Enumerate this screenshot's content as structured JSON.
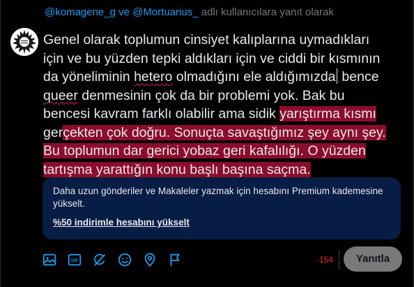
{
  "reply_context": {
    "mentions": "@komagene_g ve @Mortuarius_",
    "suffix": "adlı kullanıcılara yanıt olarak"
  },
  "compose": {
    "line1": "Genel olarak toplumun cinsiyet kalıplarına uymadıkları",
    "line2": "için ve bu yüzden tepki aldıkları için ve ciddi bir kısmının",
    "line3_pre": "da yöneliminin ",
    "line3_sq": "hetero",
    "line3_mid": " olmadığını ele aldığımızda",
    "line3_post": " bence",
    "line4_sq": "queer",
    "line4_post": " denmesinin çok da bir problemi yok. Bak bu",
    "line5_pre": "bencesi kavram farklı olabilir ama sidik ",
    "line5_hl": "yarıştırma kısmı",
    "line6_pre": "ger",
    "line6_hl": "çekten çok doğru. Sonuçta savaştığımız şey aynı şey.",
    "line7_hl": "Bu toplumun dar gerici yobaz geri kafalılığı. O yüzden",
    "line8_hl": "tartışma yarattığın konu  başlı başına saçma."
  },
  "premium": {
    "message": "Daha uzun gönderiler ve Makaleler yazmak için hesabını Premium kademesine yükselt.",
    "cta": "%50 indirimle hesabını yükselt"
  },
  "toolbar": {
    "icons": [
      "image-icon",
      "gif-icon",
      "grok-icon",
      "emoji-icon",
      "location-icon",
      "schedule-icon"
    ]
  },
  "char_counter": "-154",
  "reply_button": "Yanıtla",
  "colors": {
    "background": "#000000",
    "accent": "#1d9bf0",
    "overflow_highlight": "#8b0c2c",
    "premium_bg": "#071d46",
    "counter": "#f4212e"
  }
}
